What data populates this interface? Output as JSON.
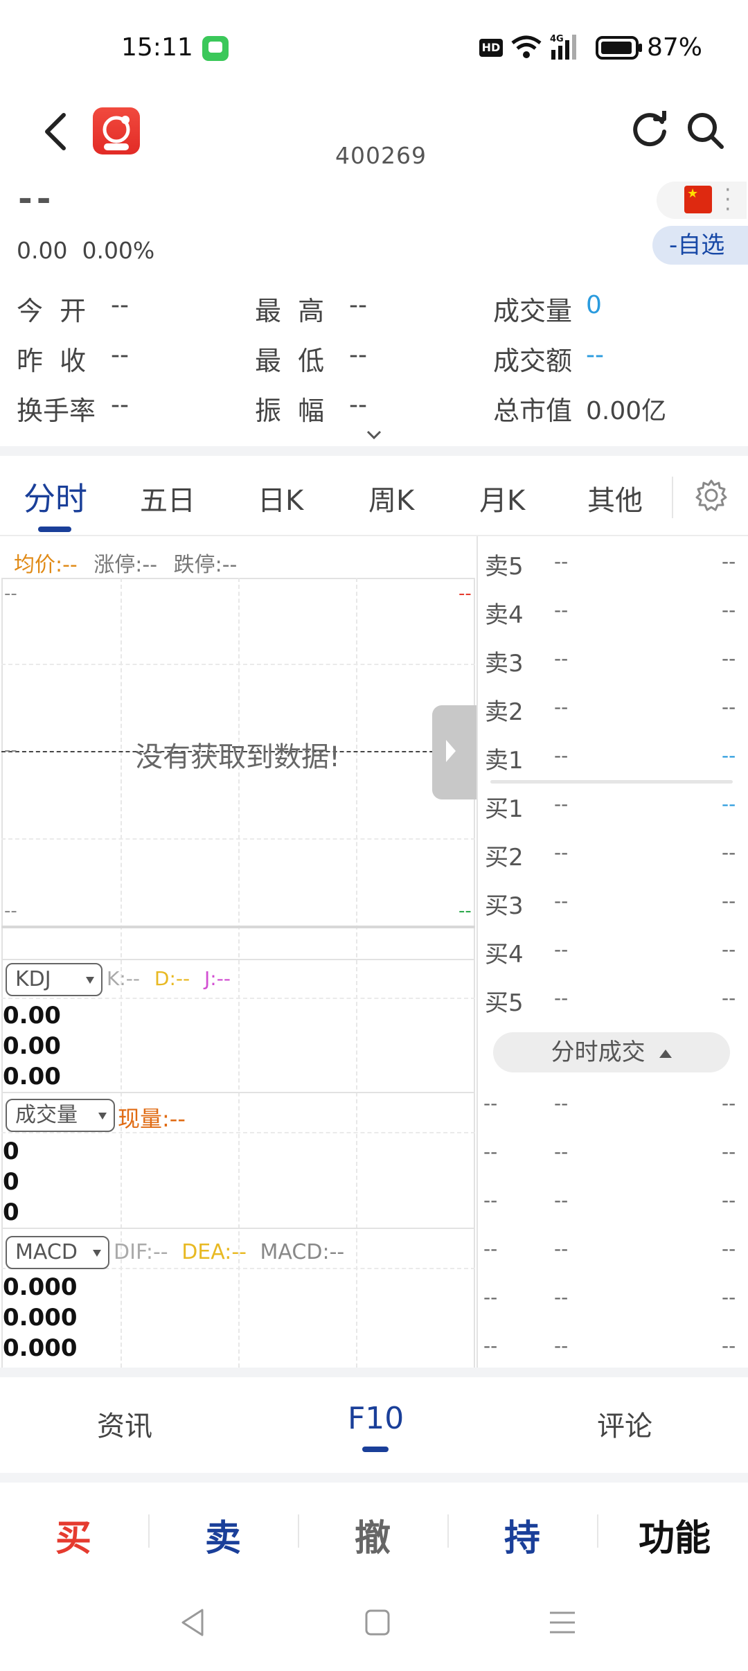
{
  "status_bar": {
    "time": "15:11",
    "hd": "HD",
    "battery": "87%",
    "icons": [
      "message-icon",
      "hd-icon",
      "wifi-icon",
      "signal-4g-icon",
      "battery-icon"
    ]
  },
  "header": {
    "code": "400269",
    "name": "--",
    "price_line": "0.00  0.00%",
    "watch_label": "-自选"
  },
  "quote": {
    "rows": [
      [
        {
          "label": "今  开",
          "value": "--"
        },
        {
          "label": "最  高",
          "value": "--"
        },
        {
          "label": "成交量",
          "value": "0"
        }
      ],
      [
        {
          "label": "昨  收",
          "value": "--"
        },
        {
          "label": "最  低",
          "value": "--"
        },
        {
          "label": "成交额",
          "value": "--"
        }
      ],
      [
        {
          "label": "换手率",
          "value": "--"
        },
        {
          "label": "振  幅",
          "value": "--"
        },
        {
          "label": "总市值",
          "value": "0.00亿"
        }
      ]
    ]
  },
  "tabs": [
    "分时",
    "五日",
    "日K",
    "周K",
    "月K",
    "其他"
  ],
  "chart": {
    "avg_label": "均价:--",
    "limit_up": "涨停:--",
    "limit_down": "跌停:--",
    "top_left": "--",
    "top_right": "--",
    "mid_left": "--",
    "bottom_left": "--",
    "bottom_right": "--",
    "no_data": "没有获取到数据!",
    "kdj": {
      "select": "KDJ",
      "k": "K:--",
      "d": "D:--",
      "j": "J:--",
      "axis": [
        "0.00",
        "0.00",
        "0.00"
      ]
    },
    "volume": {
      "select": "成交量",
      "now": "现量:--",
      "axis": [
        "0",
        "0",
        "0"
      ]
    },
    "macd": {
      "select": "MACD",
      "dif": "DIF:--",
      "dea": "DEA:--",
      "macd": "MACD:--",
      "axis": [
        "0.000",
        "0.000",
        "0.000"
      ]
    }
  },
  "order_book": {
    "sell": [
      {
        "label": "卖5",
        "price": "--",
        "vol": "--"
      },
      {
        "label": "卖4",
        "price": "--",
        "vol": "--"
      },
      {
        "label": "卖3",
        "price": "--",
        "vol": "--"
      },
      {
        "label": "卖2",
        "price": "--",
        "vol": "--"
      },
      {
        "label": "卖1",
        "price": "--",
        "vol": "--"
      }
    ],
    "buy": [
      {
        "label": "买1",
        "price": "--",
        "vol": "--"
      },
      {
        "label": "买2",
        "price": "--",
        "vol": "--"
      },
      {
        "label": "买3",
        "price": "--",
        "vol": "--"
      },
      {
        "label": "买4",
        "price": "--",
        "vol": "--"
      },
      {
        "label": "买5",
        "price": "--",
        "vol": "--"
      }
    ],
    "ticks_button": "分时成交",
    "ticks": [
      [
        "--",
        "--",
        "--"
      ],
      [
        "--",
        "--",
        "--"
      ],
      [
        "--",
        "--",
        "--"
      ],
      [
        "--",
        "--",
        "--"
      ],
      [
        "--",
        "--",
        "--"
      ],
      [
        "--",
        "--",
        "--"
      ]
    ]
  },
  "bottom_tabs": [
    "资讯",
    "F10",
    "评论"
  ],
  "trade": [
    "买",
    "卖",
    "撤",
    "持",
    "功能"
  ],
  "colors": {
    "accent": "#1a3f99",
    "red": "#e53b2f",
    "blue": "#1a3f99",
    "dark": "#111111",
    "cyan": "#2a9bde"
  }
}
